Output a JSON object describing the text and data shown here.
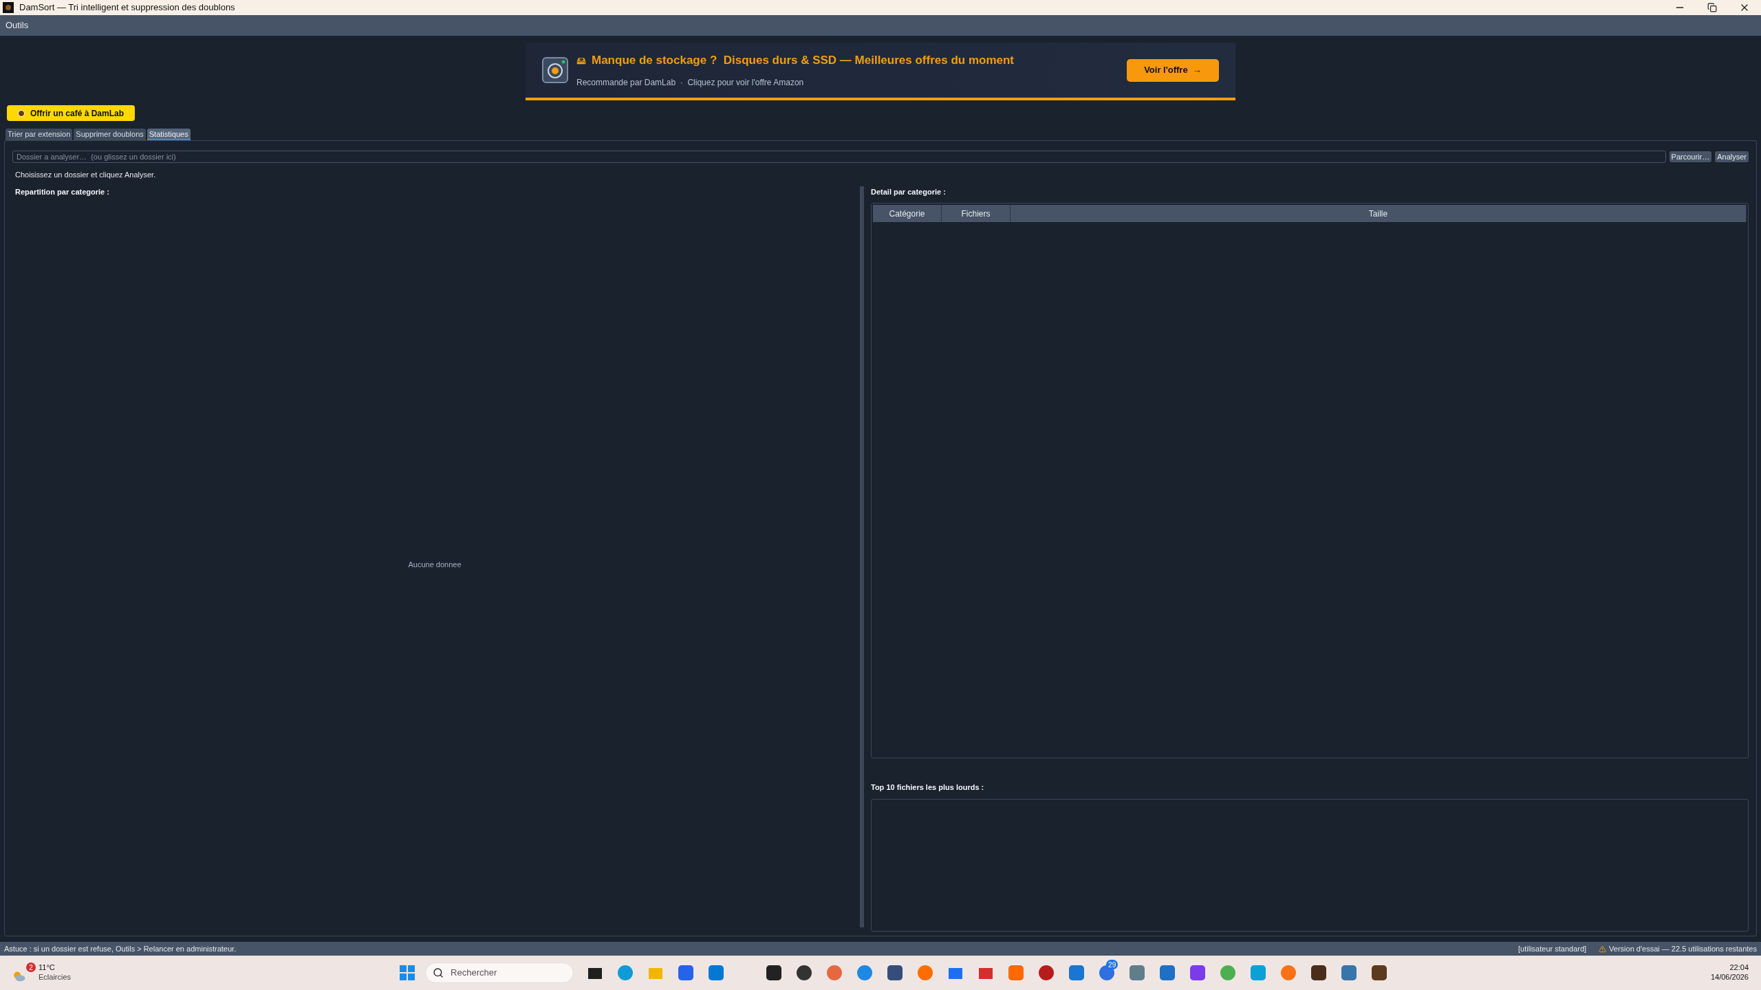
{
  "window": {
    "title": "DamSort  —  Tri intelligent et suppression des doublons"
  },
  "menu": [
    "Outils"
  ],
  "banner": {
    "emoji": "🖴",
    "title": "Manque de stockage ?  Disques durs & SSD — Meilleures offres du moment",
    "subtitle": "Recommande par DamLab  ·  Cliquez pour voir l'offre Amazon",
    "button": "Voir l'offre  →"
  },
  "coffee_button": "Offrir un café à DamLab",
  "tabs": [
    {
      "label": "Trier par extension",
      "selected": false
    },
    {
      "label": "Supprimer doublons",
      "selected": false
    },
    {
      "label": "Statistiques",
      "selected": true
    }
  ],
  "path_field": {
    "placeholder": "Dossier a analyser…  (ou glissez un dossier ici)"
  },
  "buttons": [
    "Parcourir…",
    "Analyser"
  ],
  "hint": "Choisissez un dossier et cliquez Analyser.",
  "left_panel": {
    "title": "Repartition par categorie :",
    "empty_text": "Aucune donnee"
  },
  "right_panel": {
    "title": "Detail par categorie :",
    "columns": [
      "Catégorie",
      "Fichiers",
      "Taille"
    ],
    "top_title": "Top 10 fichiers les plus lourds :"
  },
  "status_bar": {
    "tip": "Astuce : si un dossier est refuse, Outils > Relancer en administrateur.",
    "user": "[utilisateur standard]",
    "trial": "Version d'essai — 22.5 utilisations restantes"
  },
  "taskbar": {
    "weather_badge": "2",
    "temperature": "11°C",
    "weather": "Eclaircies",
    "search_placeholder": "Rechercher",
    "mail_badge": "29",
    "time": "22:04",
    "date": "14/06/2026"
  }
}
